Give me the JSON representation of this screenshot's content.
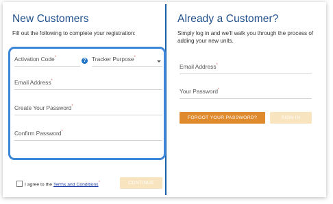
{
  "new_customers": {
    "title": "New Customers",
    "description": "Fill out the following to complete your registration:",
    "fields": {
      "activation_code": {
        "label": "Activation Code",
        "required_mark": "*"
      },
      "tracker_purpose": {
        "label": "Tracker Purpose",
        "required_mark": "*"
      },
      "email": {
        "label": "Email Address",
        "required_mark": "*"
      },
      "create_password": {
        "label": "Create Your Password",
        "required_mark": "*"
      },
      "confirm_password": {
        "label": "Confirm Password",
        "required_mark": "*"
      }
    },
    "help_icon": {
      "glyph": "?",
      "icon": "question-circle-icon"
    },
    "dropdown_icon": "chevron-down-icon",
    "terms": {
      "prefix": "I agree to the ",
      "link": "Terms and Conditions",
      "required_mark": "*"
    },
    "continue_button": "CONTINUE"
  },
  "existing_customer": {
    "title": "Already a Customer?",
    "description": "Simply log in and we'll walk you through the process of adding your new units.",
    "fields": {
      "email": {
        "label": "Email Address",
        "required_mark": "*"
      },
      "password": {
        "label": "Your Password",
        "required_mark": "*"
      }
    },
    "forgot_button": "FORGOT YOUR PASSWORD?",
    "signin_button": "SIGN IN"
  },
  "colors": {
    "title_blue": "#1f4f8b",
    "focus_border": "#3b86d9",
    "forgot_orange": "#e08a2e",
    "disabled_button": "#f8e4bf",
    "required_mark": "#d36a6a"
  }
}
